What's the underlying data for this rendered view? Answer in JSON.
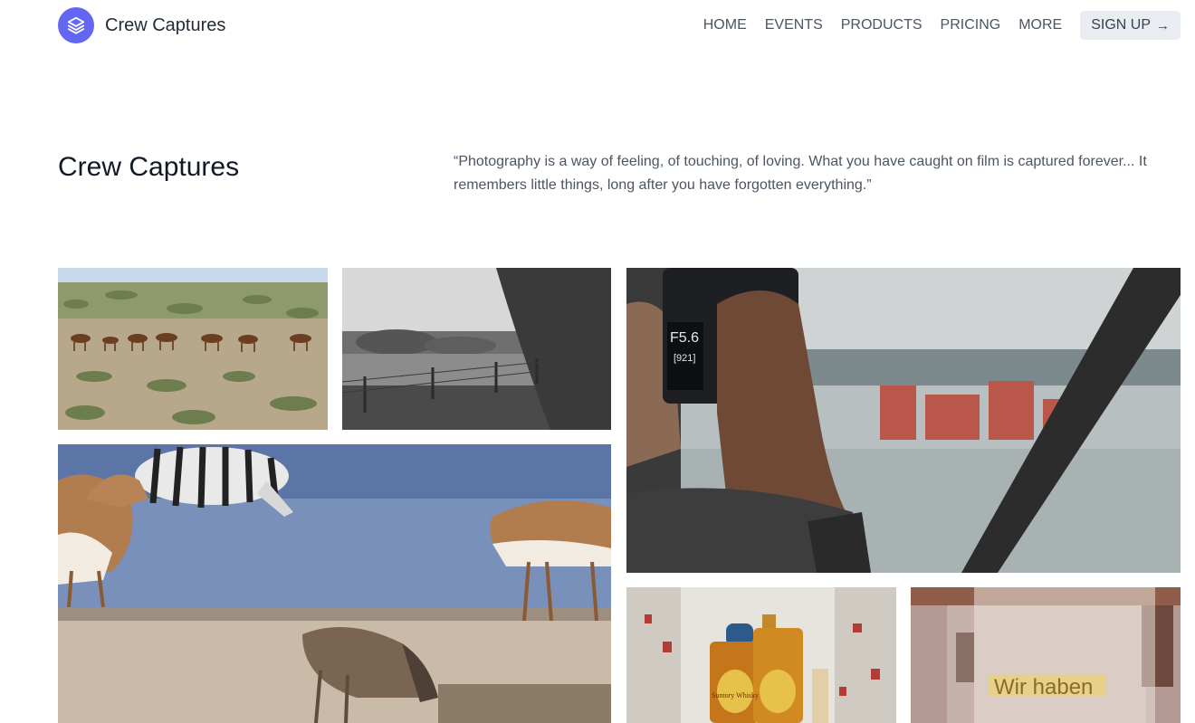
{
  "header": {
    "brand_name": "Crew Captures",
    "logo_icon": "layers-icon",
    "nav": [
      "HOME",
      "EVENTS",
      "PRODUCTS",
      "PRICING",
      "MORE"
    ],
    "signup_label": "SIGN UP",
    "signup_icon": "arrow-right-icon"
  },
  "hero": {
    "title": "Crew Captures",
    "quote": "“Photography is a way of feeling, of touching, of loving. What you have caught on film is captured forever... It remembers little things, long after you have forgotten everything.”"
  },
  "gallery": {
    "camera_display": {
      "aperture": "F5.6",
      "shots": "[921]"
    },
    "bottle_label": "Suntory Whisky",
    "sign_text": "Wir haben"
  },
  "colors": {
    "accent": "#6366f1",
    "signup_bg": "#e9edf2"
  }
}
